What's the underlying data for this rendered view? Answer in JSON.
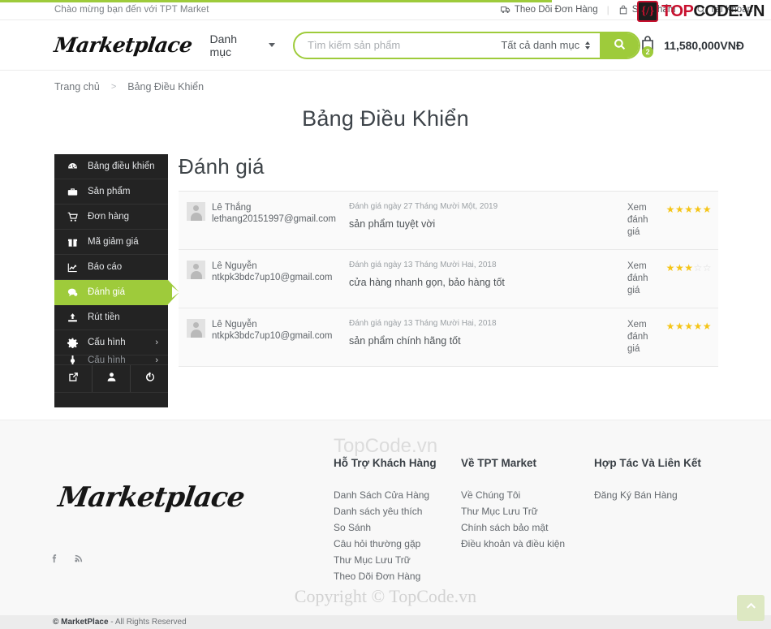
{
  "topbar": {
    "welcome": "Chào mừng bạn đến với TPT Market",
    "links": [
      {
        "icon": "truck-icon",
        "label": "Theo Dõi Đơn Hàng"
      },
      {
        "icon": "bag-icon",
        "label": "Sản Phẩm"
      },
      {
        "icon": "search-user-icon",
        "label": "Tài Khoản"
      }
    ],
    "separator": "|"
  },
  "watermark_logo": {
    "mark": "{/}",
    "top": "TOP",
    "code": "CODE",
    "vn": ".VN"
  },
  "header": {
    "brand": "Marketplace",
    "category_menu": "Danh mục",
    "search": {
      "placeholder": "Tìm kiếm sản phẩm",
      "value": "",
      "category_selected": "Tất cả danh mục"
    },
    "cart": {
      "count": "2",
      "total": "11,580,000VNĐ"
    }
  },
  "breadcrumb": {
    "home": "Trang chủ",
    "separator": ">",
    "current": "Bảng Điều Khiển"
  },
  "page": {
    "title": "Bảng Điều Khiển"
  },
  "sidebar": {
    "items": [
      {
        "label": "Bảng điều khiển",
        "icon": "dashboard-icon",
        "active": false
      },
      {
        "label": "Sản phẩm",
        "icon": "briefcase-icon",
        "active": false
      },
      {
        "label": "Đơn hàng",
        "icon": "cart-icon",
        "active": false
      },
      {
        "label": "Mã giảm giá",
        "icon": "gift-icon",
        "active": false
      },
      {
        "label": "Báo cáo",
        "icon": "chart-line-icon",
        "active": false
      },
      {
        "label": "Đánh giá",
        "icon": "comment-icon",
        "active": true
      },
      {
        "label": "Rút tiền",
        "icon": "upload-icon",
        "active": false
      },
      {
        "label": "Cấu hình",
        "icon": "gear-icon",
        "active": false,
        "chevron": "›"
      }
    ],
    "clipped_item": {
      "label": "Cấu hình",
      "chevron": "›"
    },
    "actions": [
      {
        "icon": "external-link-icon",
        "name": "visit-store"
      },
      {
        "icon": "user-icon",
        "name": "profile"
      },
      {
        "icon": "power-icon",
        "name": "logout"
      }
    ]
  },
  "panel": {
    "title": "Đánh giá",
    "reviews": [
      {
        "name": "Lê Thắng",
        "email": "lethang20151997@gmail.com",
        "date": "Đánh giá ngày 27 Tháng Mười Một, 2019",
        "text": "sản phẩm tuyệt vời",
        "action": "Xem đánh giá",
        "rating": 5
      },
      {
        "name": "Lê Nguyễn",
        "email": "ntkpk3bdc7up10@gmail.com",
        "date": "Đánh giá ngày 13 Tháng Mười Hai, 2018",
        "text": "cửa hàng nhanh gọn, bảo hàng tốt",
        "action": "Xem đánh giá",
        "rating": 3
      },
      {
        "name": "Lê Nguyễn",
        "email": "ntkpk3bdc7up10@gmail.com",
        "date": "Đánh giá ngày 13 Tháng Mười Hai, 2018",
        "text": "sản phẩm chính hãng tốt",
        "action": "Xem đánh giá",
        "rating": 5
      }
    ]
  },
  "footer": {
    "watermark": "TopCode.vn",
    "brand": "Marketplace",
    "social": [
      {
        "icon": "facebook-icon",
        "label": "f"
      },
      {
        "icon": "rss-icon",
        "label": "rss"
      }
    ],
    "columns": [
      {
        "title": "Hỗ Trợ Khách Hàng",
        "links": [
          "Danh Sách Cửa Hàng",
          "Danh sách yêu thích",
          "So Sánh",
          "Câu hỏi thường gặp",
          "Thư Mục Lưu Trữ",
          "Theo Dõi Đơn Hàng"
        ]
      },
      {
        "title": "Về TPT Market",
        "links": [
          "Về Chúng Tôi",
          "Thư Mục Lưu Trữ",
          "Chính sách bảo mật",
          "Điều khoản và điều kiện"
        ]
      },
      {
        "title": "Hợp Tác Và Liên Kết",
        "links": [
          "Đăng Ký Bán Hàng"
        ]
      }
    ]
  },
  "copyright_watermark": "Copyright © TopCode.vn",
  "bottombar": {
    "brand": "© MarketPlace",
    "rights": " - All Rights Reserved"
  },
  "colors": {
    "accent_green": "#9ecb3b",
    "sidebar_dark": "#232323",
    "star_gold": "#f5c518",
    "brand_red": "#c8102e"
  }
}
